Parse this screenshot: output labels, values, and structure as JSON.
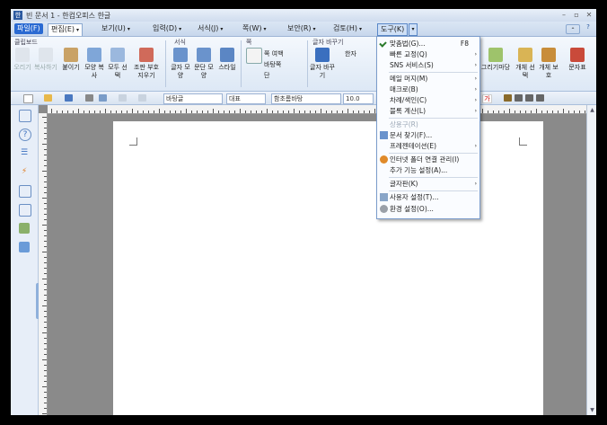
{
  "window": {
    "title": "빈 문서 1 - 한컴오피스 한글",
    "logo": "한"
  },
  "menu_tabs": [
    {
      "label": "파일(F)"
    },
    {
      "label": "편집(E)"
    },
    {
      "label": "보기(U)"
    },
    {
      "label": "입력(D)"
    },
    {
      "label": "서식(J)"
    },
    {
      "label": "쪽(W)"
    },
    {
      "label": "보안(R)"
    },
    {
      "label": "검토(H)"
    },
    {
      "label": "도구(K)"
    }
  ],
  "ribbon": {
    "groups": {
      "clipboard": "클립보드",
      "format": "서식",
      "page": "쪽",
      "char": "글자 바꾸기"
    },
    "buttons": {
      "cut": "오리기",
      "copy": "복사하기",
      "paste": "붙이기",
      "paste_special": "모양 복사",
      "select_all": "모두 선택",
      "find_replace": "조판 부호 지우기",
      "char_shape": "글자 모양",
      "para_shape": "문단 모양",
      "style": "스타일",
      "page_margin": "쪽 여백",
      "page_border": "바탕쪽",
      "multi_col": "단",
      "char_convert": "글자 바꾸기",
      "hanja": "한자",
      "draw": "그리기마당",
      "obj_select": "개체 선택",
      "obj_protect": "개체 보호",
      "char_map": "문자표"
    }
  },
  "format_bar": {
    "font_lang": "바탕글",
    "style": "대표",
    "font": "함초롬바탕",
    "size": "10.0"
  },
  "tools_menu": {
    "items": [
      {
        "label": "맞춤법(G)...",
        "shortcut": "F8",
        "icon": "spellcheck-icon"
      },
      {
        "label": "빠른 교정(Q)",
        "arrow": "›"
      },
      {
        "label": "SNS 서비스(S)",
        "arrow": "›"
      },
      {
        "label": "메일 머지(M)",
        "arrow": "›"
      },
      {
        "label": "매크로(B)",
        "arrow": "›"
      },
      {
        "label": "차례/색인(C)",
        "arrow": "›"
      },
      {
        "label": "블록 계산(L)",
        "arrow": "›"
      },
      {
        "label": "상용구(R)",
        "disabled": true
      },
      {
        "label": "문서 찾기(F)...",
        "icon": "find-doc-icon"
      },
      {
        "label": "프레젠테이션(E)",
        "arrow": "›"
      },
      {
        "label": "인터넷 폴더 연결 관리(I)",
        "icon": "internet-folder-icon"
      },
      {
        "label": "추가 기능 설정(A)..."
      },
      {
        "label": "글자판(K)",
        "arrow": "›"
      },
      {
        "label": "사용자 설정(T)...",
        "icon": "user-settings-icon"
      },
      {
        "label": "환경 설정(O)...",
        "icon": "env-settings-icon"
      }
    ]
  },
  "colors": {
    "accent": "#2a6ad2",
    "menu_border": "#7b9ccb",
    "workspace": "#8a8a8a"
  }
}
